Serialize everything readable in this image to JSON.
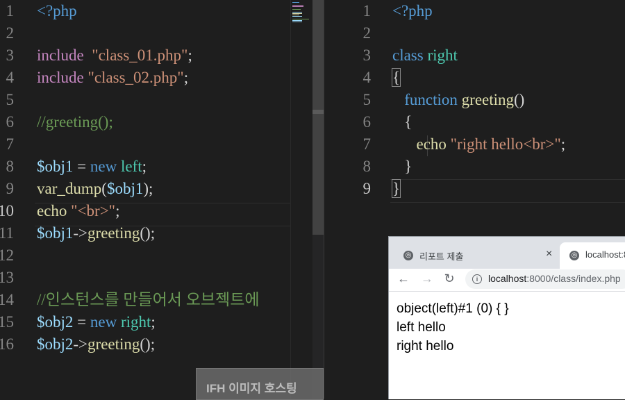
{
  "left_editor": {
    "lines": [
      {
        "num": "1",
        "tokens": [
          {
            "t": "<?php",
            "c": "kw"
          }
        ]
      },
      {
        "num": "2",
        "tokens": []
      },
      {
        "num": "3",
        "tokens": [
          {
            "t": "include",
            "c": "ctl"
          },
          {
            "t": "  ",
            "c": "def"
          },
          {
            "t": "\"class_01.php\"",
            "c": "str"
          },
          {
            "t": ";",
            "c": "def"
          }
        ]
      },
      {
        "num": "4",
        "tokens": [
          {
            "t": "include",
            "c": "ctl"
          },
          {
            "t": " ",
            "c": "def"
          },
          {
            "t": "\"class_02.php\"",
            "c": "str"
          },
          {
            "t": ";",
            "c": "def"
          }
        ]
      },
      {
        "num": "5",
        "tokens": []
      },
      {
        "num": "6",
        "tokens": [
          {
            "t": "//greeting();",
            "c": "com"
          }
        ]
      },
      {
        "num": "7",
        "tokens": []
      },
      {
        "num": "8",
        "tokens": [
          {
            "t": "$obj1",
            "c": "var"
          },
          {
            "t": " = ",
            "c": "def"
          },
          {
            "t": "new",
            "c": "kw"
          },
          {
            "t": " ",
            "c": "def"
          },
          {
            "t": "left",
            "c": "cls"
          },
          {
            "t": ";",
            "c": "def"
          }
        ]
      },
      {
        "num": "9",
        "tokens": [
          {
            "t": "var_dump",
            "c": "fn"
          },
          {
            "t": "(",
            "c": "def"
          },
          {
            "t": "$obj1",
            "c": "var"
          },
          {
            "t": ");",
            "c": "def"
          }
        ]
      },
      {
        "num": "10",
        "tokens": [
          {
            "t": "echo",
            "c": "fn"
          },
          {
            "t": " ",
            "c": "def"
          },
          {
            "t": "\"<br>\"",
            "c": "str"
          },
          {
            "t": ";",
            "c": "def"
          }
        ]
      },
      {
        "num": "11",
        "tokens": [
          {
            "t": "$obj1",
            "c": "var"
          },
          {
            "t": "->",
            "c": "def"
          },
          {
            "t": "greeting",
            "c": "fn"
          },
          {
            "t": "();",
            "c": "def"
          }
        ]
      },
      {
        "num": "12",
        "tokens": []
      },
      {
        "num": "13",
        "tokens": []
      },
      {
        "num": "14",
        "tokens": [
          {
            "t": "//인스턴스를 만들어서 오브젝트에",
            "c": "com"
          }
        ]
      },
      {
        "num": "15",
        "tokens": [
          {
            "t": "$obj2",
            "c": "var"
          },
          {
            "t": " = ",
            "c": "def"
          },
          {
            "t": "new",
            "c": "kw"
          },
          {
            "t": " ",
            "c": "def"
          },
          {
            "t": "right",
            "c": "cls"
          },
          {
            "t": ";",
            "c": "def"
          }
        ]
      },
      {
        "num": "16",
        "tokens": [
          {
            "t": "$obj2",
            "c": "var"
          },
          {
            "t": "->",
            "c": "def"
          },
          {
            "t": "greeting",
            "c": "fn"
          },
          {
            "t": "();",
            "c": "def"
          }
        ]
      }
    ],
    "active_line": "10"
  },
  "right_editor": {
    "lines": [
      {
        "num": "1",
        "tokens": [
          {
            "t": "<?php",
            "c": "kw"
          }
        ]
      },
      {
        "num": "2",
        "tokens": []
      },
      {
        "num": "3",
        "tokens": [
          {
            "t": "class",
            "c": "kw"
          },
          {
            "t": " ",
            "c": "def"
          },
          {
            "t": "right",
            "c": "cls"
          }
        ]
      },
      {
        "num": "4",
        "tokens": [
          {
            "t": "{",
            "c": "brk"
          }
        ]
      },
      {
        "num": "5",
        "tokens": [
          {
            "t": "   ",
            "c": "def"
          },
          {
            "t": "function",
            "c": "kw"
          },
          {
            "t": " ",
            "c": "def"
          },
          {
            "t": "greeting",
            "c": "fn"
          },
          {
            "t": "()",
            "c": "def"
          }
        ]
      },
      {
        "num": "6",
        "tokens": [
          {
            "t": "   {",
            "c": "def"
          }
        ]
      },
      {
        "num": "7",
        "tokens": [
          {
            "t": "      ",
            "c": "def"
          },
          {
            "t": "echo",
            "c": "fn"
          },
          {
            "t": " ",
            "c": "def"
          },
          {
            "t": "\"right hello<br>\"",
            "c": "str"
          },
          {
            "t": ";",
            "c": "def"
          }
        ]
      },
      {
        "num": "8",
        "tokens": [
          {
            "t": "   }",
            "c": "def"
          }
        ]
      },
      {
        "num": "9",
        "tokens": [
          {
            "t": "}",
            "c": "brk"
          }
        ]
      }
    ],
    "active_line": "9"
  },
  "browser": {
    "tab_inactive_title": "리포트 제출",
    "tab_active_title": "localhost:8",
    "tab_close": "×",
    "url_host": "localhost",
    "url_path": ":8000/class/index.php",
    "output_lines": [
      "object(left)#1 (0) { }",
      "left hello",
      "right hello"
    ]
  },
  "watermark": {
    "text": "IFH 이미지 호스팅"
  },
  "colors": {
    "editor_bg": "#1e1e1e",
    "keyword": "#569cd6",
    "control": "#c586c0",
    "string": "#ce9178",
    "variable": "#9cdcfe",
    "function": "#dcdcaa",
    "class": "#4ec9b0",
    "comment": "#6a9955"
  }
}
